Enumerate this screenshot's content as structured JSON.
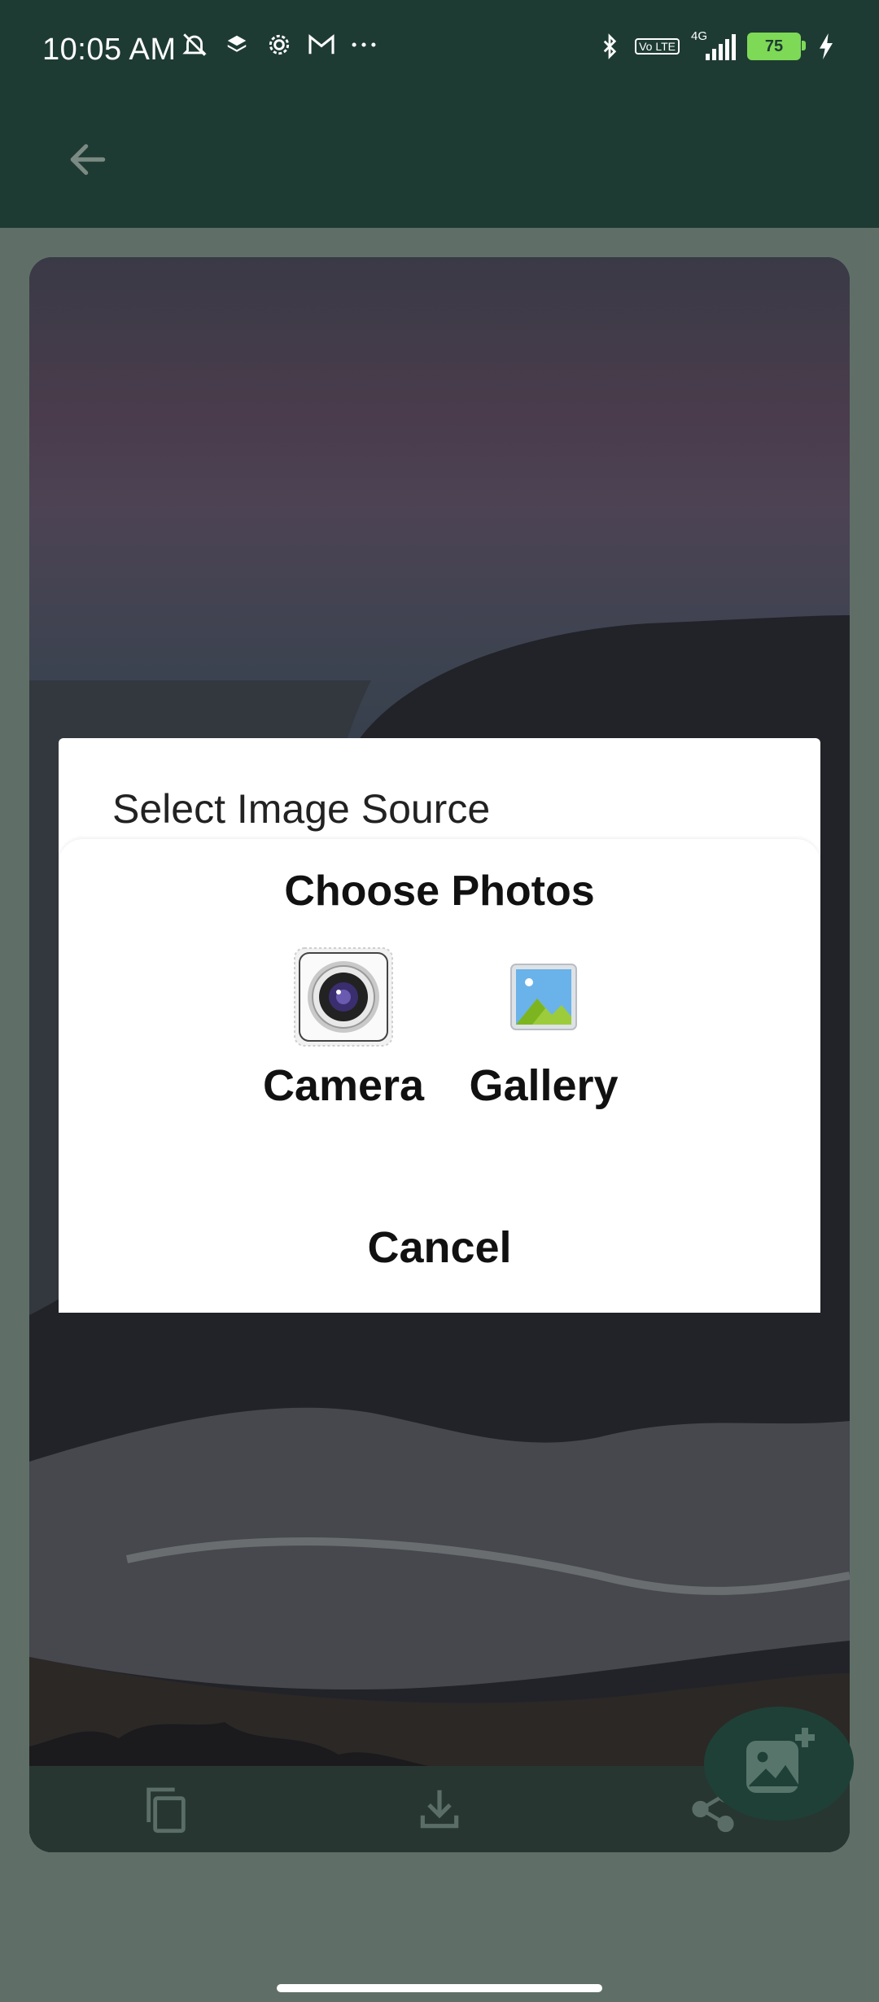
{
  "status_bar": {
    "time": "10:05 AM",
    "network": "4G",
    "volte": "Vo LTE",
    "battery": "75",
    "icons_left": [
      "bell-off-icon",
      "layers-icon",
      "gear-icon",
      "gmail-icon",
      "more-dots-icon"
    ],
    "icons_right": [
      "bluetooth-icon",
      "volte-icon",
      "signal-icon",
      "battery-icon",
      "charging-icon"
    ]
  },
  "app_bar": {
    "back_icon": "arrow-left-icon"
  },
  "dialog": {
    "title": "Select Image Source",
    "subtitle": "Choose Photos",
    "options": [
      {
        "label": "Camera",
        "icon": "camera-icon"
      },
      {
        "label": "Gallery",
        "icon": "gallery-icon"
      }
    ],
    "cancel_label": "Cancel"
  },
  "toolbar": {
    "icons": [
      "copy-icon",
      "download-icon",
      "share-icon"
    ]
  },
  "fab": {
    "icon": "add-photo-icon"
  },
  "colors": {
    "app_bar": "#1e3b33",
    "dim_background": "#5f6f68",
    "dialog": "#ffffff",
    "fab": "#1f4037"
  }
}
